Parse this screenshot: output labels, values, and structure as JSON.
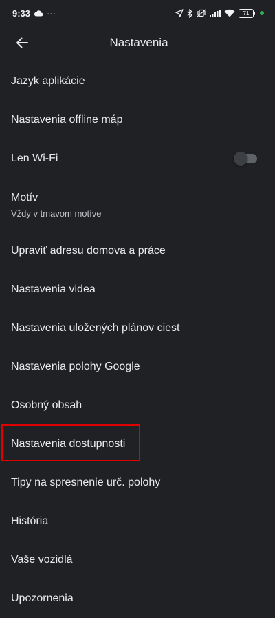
{
  "status_bar": {
    "time": "9:33",
    "more": "···",
    "battery_level": "71"
  },
  "header": {
    "title": "Nastavenia"
  },
  "settings": {
    "items": [
      {
        "label": "Jazyk aplikácie"
      },
      {
        "label": "Nastavenia offline máp"
      },
      {
        "label": "Len Wi-Fi",
        "toggle_on": false
      },
      {
        "label": "Motív",
        "subtitle": "Vždy v tmavom motíve"
      },
      {
        "label": "Upraviť adresu domova a práce"
      },
      {
        "label": "Nastavenia videa"
      },
      {
        "label": "Nastavenia uložených plánov ciest"
      },
      {
        "label": "Nastavenia polohy Google"
      },
      {
        "label": "Osobný obsah"
      },
      {
        "label": "Nastavenia dostupnosti"
      },
      {
        "label": "Tipy na spresnenie urč. polohy"
      },
      {
        "label": "História"
      },
      {
        "label": "Vaše vozidlá"
      },
      {
        "label": "Upozornenia"
      }
    ]
  },
  "colors": {
    "background": "#202124",
    "text": "#e8eaed",
    "highlight_border": "#e00000"
  }
}
